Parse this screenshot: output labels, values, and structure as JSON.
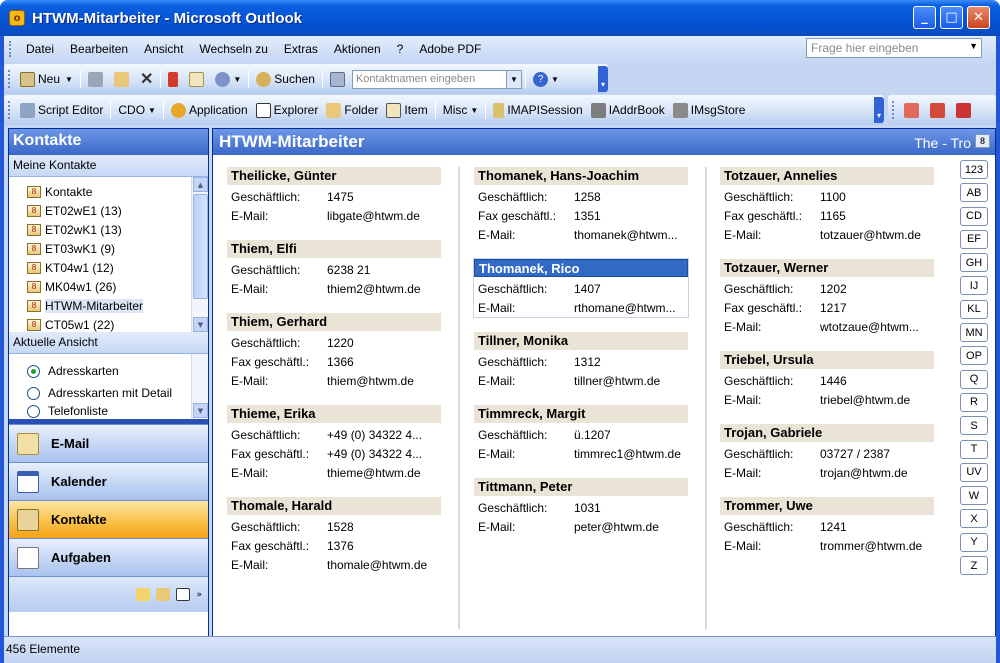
{
  "window": {
    "title": "HTWM-Mitarbeiter - Microsoft Outlook",
    "min": "_",
    "max": "□",
    "close": "✕"
  },
  "menu": {
    "items": [
      "Datei",
      "Bearbeiten",
      "Ansicht",
      "Wechseln zu",
      "Extras",
      "Aktionen",
      "?",
      "Adobe PDF"
    ],
    "ask_placeholder": "Frage hier eingeben"
  },
  "toolbar1": {
    "new": "Neu",
    "find": "Suchen",
    "contact_search_placeholder": "Kontaktnamen eingeben"
  },
  "toolbar2": {
    "items": [
      "Script Editor",
      "CDO",
      "Application",
      "Explorer",
      "Folder",
      "Item",
      "Misc",
      "IMAPISession",
      "IAddrBook",
      "IMsgStore"
    ]
  },
  "nav": {
    "header": "Kontakte",
    "my_contacts": "Meine Kontakte",
    "folders": [
      "Kontakte",
      "ET02wE1 (13)",
      "ET02wK1 (13)",
      "ET03wK1 (9)",
      "KT04w1 (12)",
      "MK04w1 (26)",
      "HTWM-Mitarbeiter",
      "CT05w1 (22)"
    ],
    "current_view": "Aktuelle Ansicht",
    "views": [
      "Adresskarten",
      "Adresskarten mit Detail",
      "Telefonliste"
    ],
    "buttons": [
      "E-Mail",
      "Kalender",
      "Kontakte",
      "Aufgaben"
    ]
  },
  "main": {
    "header": "HTWM-Mitarbeiter",
    "range": "The - Tro",
    "labels": {
      "business": "Geschäftlich:",
      "fax": "Fax geschäftl.:",
      "email": "E-Mail:"
    },
    "columns": [
      [
        {
          "name": "Theilicke, Günter",
          "business": "1475",
          "email": "libgate@htwm.de"
        },
        {
          "name": "Thiem, Elfi",
          "business": "6238 21",
          "email": "thiem2@htwm.de"
        },
        {
          "name": "Thiem, Gerhard",
          "business": "1220",
          "fax": "1366",
          "email": "thiem@htwm.de"
        },
        {
          "name": "Thieme, Erika",
          "business": "+49 (0) 34322 4...",
          "fax": "+49 (0) 34322 4...",
          "email": "thieme@htwm.de"
        },
        {
          "name": "Thomale, Harald",
          "business": "1528",
          "fax": "1376",
          "email": "thomale@htwm.de"
        }
      ],
      [
        {
          "name": "Thomanek, Hans-Joachim",
          "business": "1258",
          "fax": "1351",
          "email": "thomanek@htwm..."
        },
        {
          "name": "Thomanek, Rico",
          "business": "1407",
          "email": "rthomane@htwm...",
          "selected": true
        },
        {
          "name": "Tillner, Monika",
          "business": "1312",
          "email": "tillner@htwm.de"
        },
        {
          "name": "Timmreck, Margit",
          "business": "ü.1207",
          "email": "timmrec1@htwm.de"
        },
        {
          "name": "Tittmann, Peter",
          "business": "1031",
          "email": "peter@htwm.de"
        }
      ],
      [
        {
          "name": "Totzauer, Annelies",
          "business": "1100",
          "fax": "1165",
          "email": "totzauer@htwm.de"
        },
        {
          "name": "Totzauer, Werner",
          "business": "1202",
          "fax": "1217",
          "email": "wtotzaue@htwm..."
        },
        {
          "name": "Triebel, Ursula",
          "business": "1446",
          "email": "triebel@htwm.de"
        },
        {
          "name": "Trojan, Gabriele",
          "business": "03727 / 2387",
          "email": "trojan@htwm.de"
        },
        {
          "name": "Trommer, Uwe",
          "business": "1241",
          "email": "trommer@htwm.de"
        }
      ]
    ],
    "alpha": [
      "123",
      "AB",
      "CD",
      "EF",
      "GH",
      "IJ",
      "KL",
      "MN",
      "OP",
      "Q",
      "R",
      "S",
      "T",
      "UV",
      "W",
      "X",
      "Y",
      "Z"
    ]
  },
  "status": {
    "text": "456 Elemente"
  }
}
